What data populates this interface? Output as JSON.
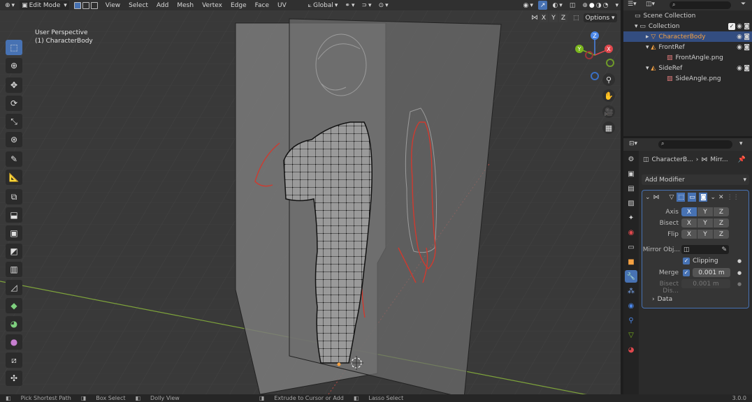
{
  "header": {
    "mode": "Edit Mode",
    "menus": [
      "View",
      "Select",
      "Add",
      "Mesh",
      "Vertex",
      "Edge",
      "Face",
      "UV"
    ],
    "transform_orientation": "Global"
  },
  "viewport": {
    "perspective_label": "User Perspective",
    "object_label": "(1) CharacterBody",
    "mirror_axes": [
      "X",
      "Y",
      "Z"
    ],
    "options_label": "Options",
    "gizmo": {
      "x": "X",
      "y": "Y",
      "z": "Z"
    }
  },
  "outliner": {
    "search_placeholder": "",
    "items": [
      {
        "label": "Scene Collection"
      },
      {
        "label": "Collection"
      },
      {
        "label": "CharacterBody"
      },
      {
        "label": "FrontRef"
      },
      {
        "label": "FrontAngle.png"
      },
      {
        "label": "SideRef"
      },
      {
        "label": "SideAngle.png"
      }
    ]
  },
  "properties": {
    "breadcrumb_object": "CharacterB...",
    "breadcrumb_modifier": "Mirr...",
    "add_modifier": "Add Modifier",
    "axis_label": "Axis",
    "bisect_label": "Bisect",
    "flip_label": "Flip",
    "axis_x": "X",
    "axis_y": "Y",
    "axis_z": "Z",
    "mirror_object_label": "Mirror Obj...",
    "clipping_label": "Clipping",
    "merge_label": "Merge",
    "merge_value": "0.001 m",
    "bisect_distance_label": "Bisect Dis...",
    "bisect_distance_value": "0.001 m",
    "data_label": "Data"
  },
  "status": {
    "items": [
      "Pick Shortest Path",
      "Box Select",
      "Dolly View",
      "Extrude to Cursor or Add",
      "Lasso Select"
    ],
    "version": "3.0.0"
  },
  "colors": {
    "accent": "#4772b3",
    "outline_red": "#d03a2f",
    "grid_green": "#7ea33b"
  }
}
